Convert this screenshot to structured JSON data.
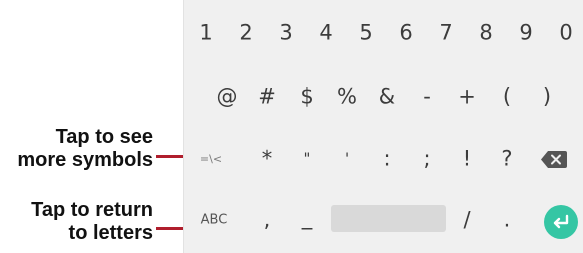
{
  "annotations": {
    "callout1_line1": "Tap to see",
    "callout1_line2": "more symbols",
    "callout2_line1": "Tap to return",
    "callout2_line2": "to letters"
  },
  "keyboard": {
    "number_row": [
      "1",
      "2",
      "3",
      "4",
      "5",
      "6",
      "7",
      "8",
      "9",
      "0"
    ],
    "symbol_row": [
      "@",
      "#",
      "$",
      "%",
      "&",
      "-",
      "+",
      "(",
      ")"
    ],
    "third_row": {
      "more_symbols_key": "=\\<",
      "keys": [
        "*",
        "\"",
        "'",
        ":",
        ";",
        "!",
        "?"
      ],
      "backspace_icon": "backspace-icon"
    },
    "bottom_row": {
      "letters_key": "ABC",
      "comma": ",",
      "underscore": "_",
      "space_icon": "spacebar",
      "slash": "/",
      "period": ".",
      "enter_icon": "enter-arrow-icon",
      "enter_color": "#35c6a4"
    }
  }
}
